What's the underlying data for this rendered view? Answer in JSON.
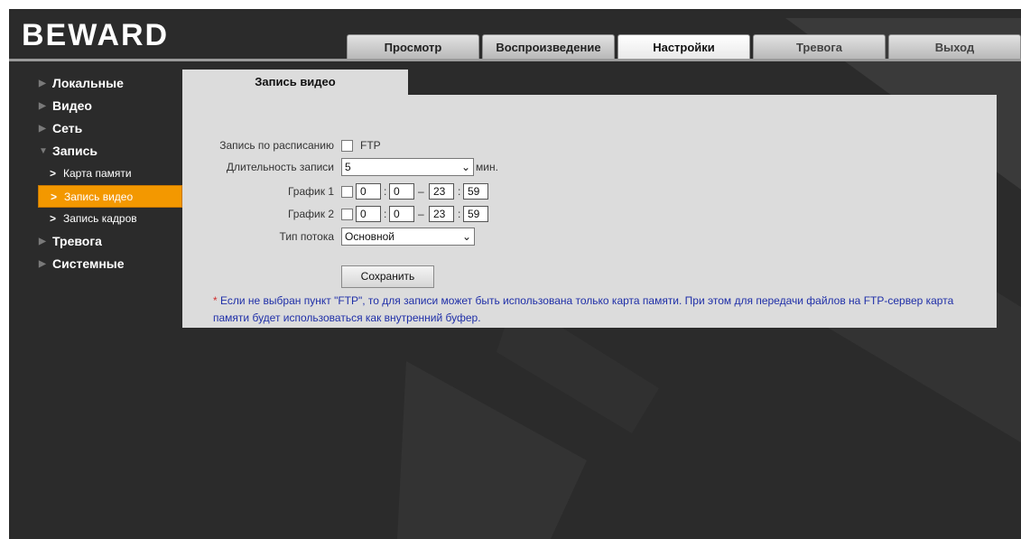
{
  "brand": {
    "logo_text": "BEWARD"
  },
  "nav": {
    "tabs": [
      {
        "label": "Просмотр",
        "active": false
      },
      {
        "label": "Воспроизведение",
        "active": false
      },
      {
        "label": "Настройки",
        "active": true
      },
      {
        "label": "Тревога",
        "active": false
      },
      {
        "label": "Выход",
        "active": false
      }
    ]
  },
  "sidebar": {
    "items": [
      {
        "label": "Локальные",
        "expanded": false
      },
      {
        "label": "Видео",
        "expanded": false
      },
      {
        "label": "Сеть",
        "expanded": false
      },
      {
        "label": "Запись",
        "expanded": true
      },
      {
        "label": "Тревога",
        "expanded": false
      },
      {
        "label": "Системные",
        "expanded": false
      }
    ],
    "subitems": [
      {
        "label": "Карта памяти",
        "active": false
      },
      {
        "label": "Запись видео",
        "active": true
      },
      {
        "label": "Запись кадров",
        "active": false
      }
    ]
  },
  "content": {
    "tab_title": "Запись видео",
    "schedule_label": "Запись по расписанию",
    "ftp_label": "FTP",
    "ftp_checked": false,
    "duration_label": "Длительность записи",
    "duration_value": "5",
    "duration_unit": "мин.",
    "schedule1": {
      "label": "График 1",
      "checked": false,
      "from_h": "0",
      "from_m": "0",
      "to_h": "23",
      "to_m": "59"
    },
    "schedule2": {
      "label": "График 2",
      "checked": false,
      "from_h": "0",
      "from_m": "0",
      "to_h": "23",
      "to_m": "59"
    },
    "stream_label": "Тип потока",
    "stream_value": "Основной",
    "save_label": "Сохранить",
    "note_star": "*",
    "note_line1": "Если не выбран пункт \"FTP\", то для записи может быть использована только карта памяти. При этом для передачи файлов на FTP-сервер карта",
    "note_line2": "памяти будет использоваться как внутренний буфер."
  },
  "colors": {
    "accent": "#f39800",
    "background": "#2b2b2b",
    "panel": "#dcdcdc",
    "note": "#1f2fa8"
  }
}
